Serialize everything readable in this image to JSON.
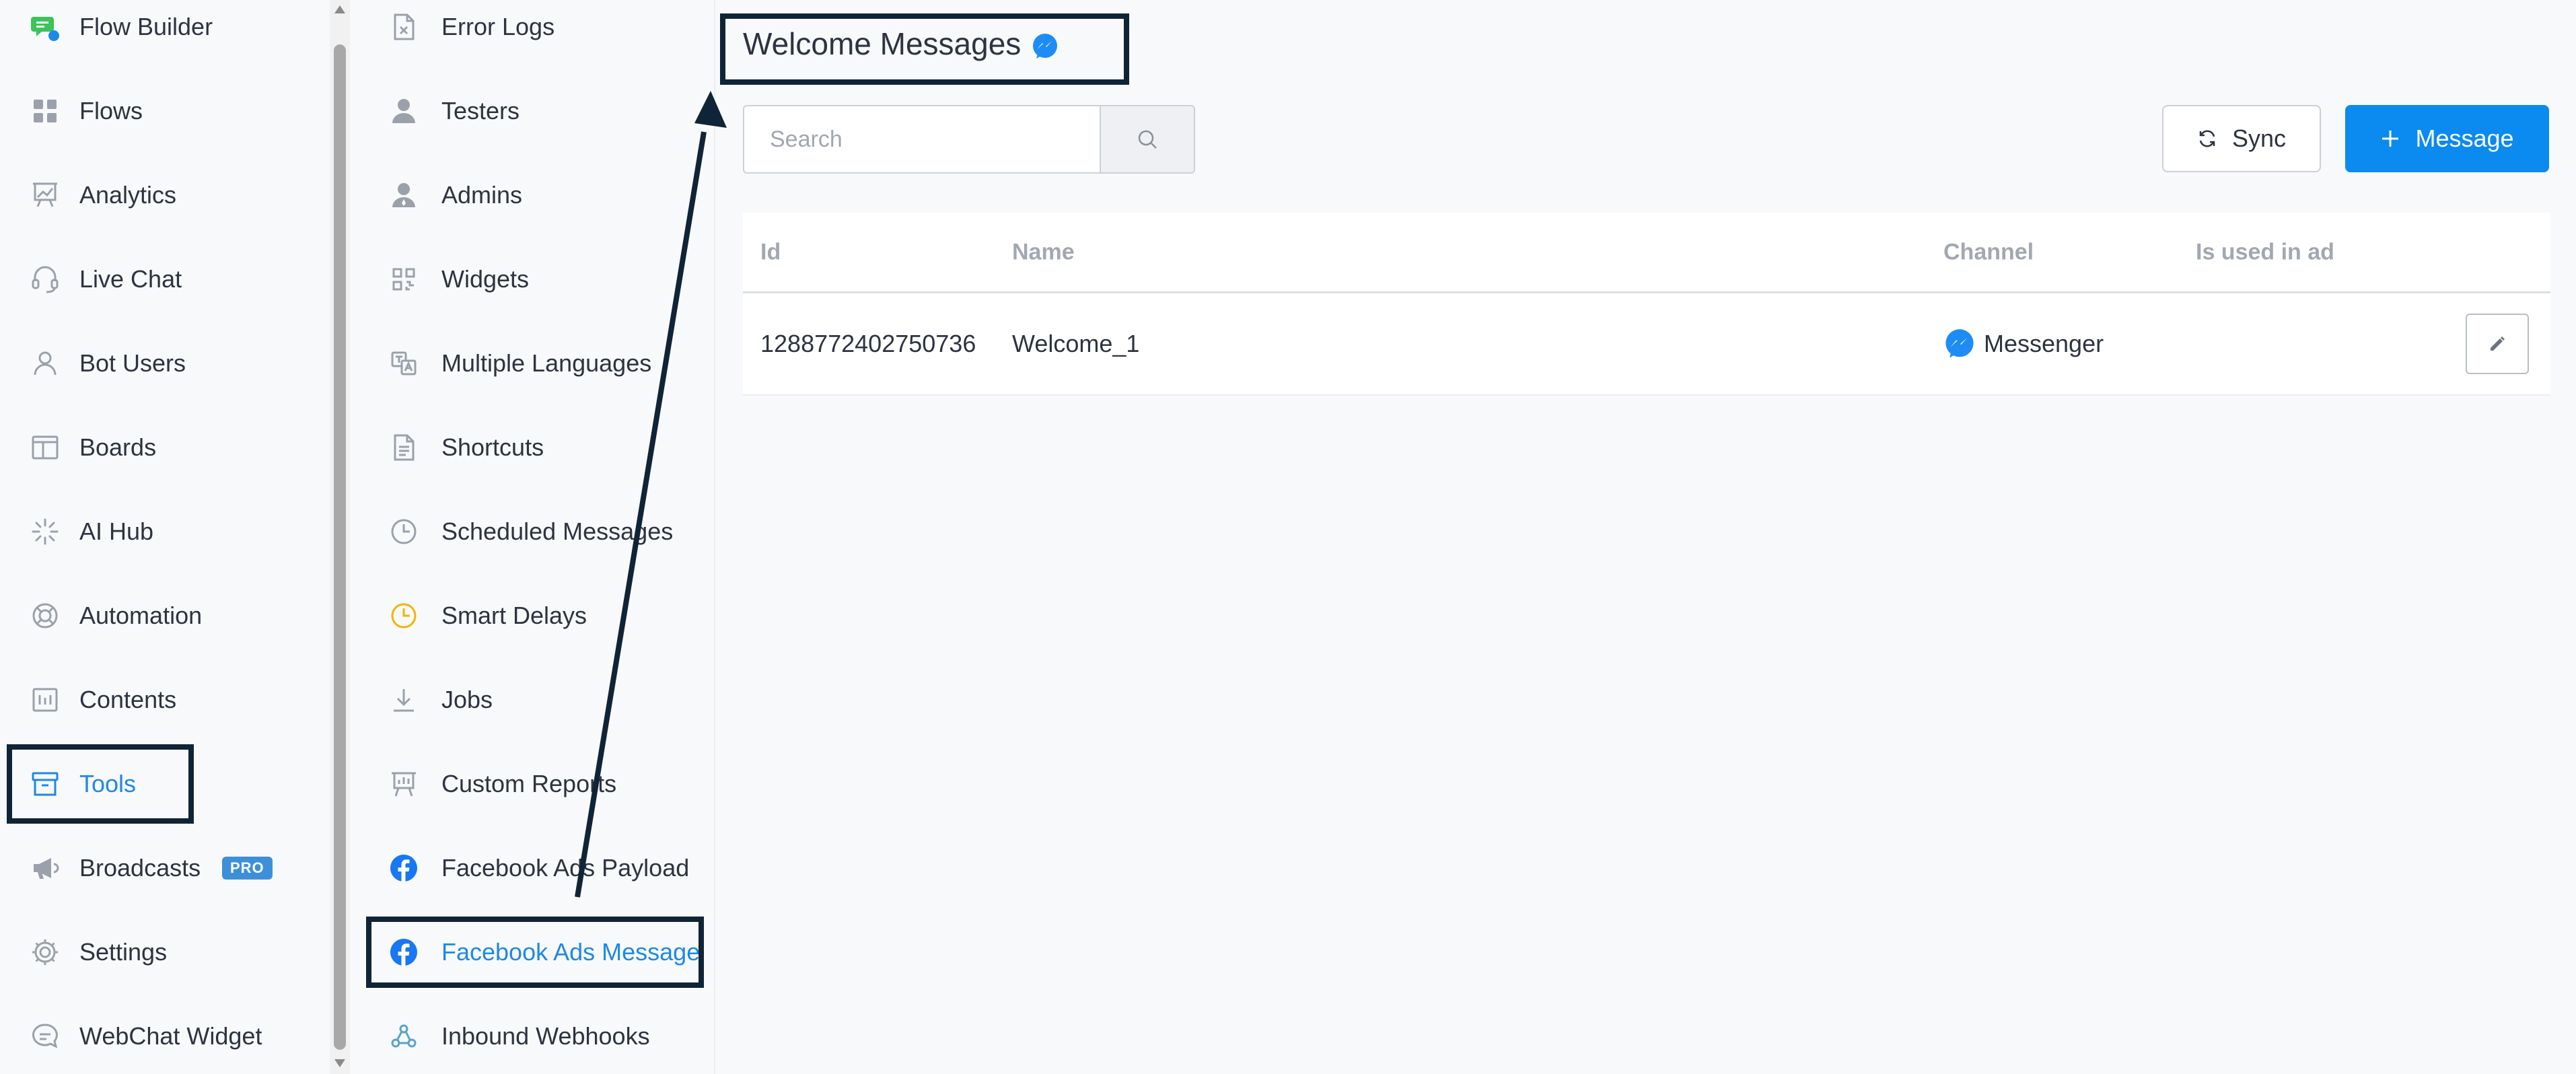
{
  "sidebar": {
    "items": [
      {
        "label": "Flow Builder",
        "icon": "flow-builder-icon"
      },
      {
        "label": "Flows",
        "icon": "grid-icon"
      },
      {
        "label": "Analytics",
        "icon": "chart-icon"
      },
      {
        "label": "Live Chat",
        "icon": "headset-icon"
      },
      {
        "label": "Bot Users",
        "icon": "user-icon"
      },
      {
        "label": "Boards",
        "icon": "board-icon"
      },
      {
        "label": "AI Hub",
        "icon": "sparkle-icon"
      },
      {
        "label": "Automation",
        "icon": "lifebuoy-icon"
      },
      {
        "label": "Contents",
        "icon": "contents-icon"
      },
      {
        "label": "Tools",
        "icon": "archive-box-icon"
      },
      {
        "label": "Broadcasts",
        "icon": "megaphone-icon",
        "badge": "PRO"
      },
      {
        "label": "Settings",
        "icon": "gear-icon"
      },
      {
        "label": "WebChat Widget",
        "icon": "chat-bubble-icon"
      }
    ],
    "active": "Tools"
  },
  "submenu": {
    "items": [
      {
        "label": "Error Logs",
        "icon": "error-file-icon"
      },
      {
        "label": "Testers",
        "icon": "person-icon"
      },
      {
        "label": "Admins",
        "icon": "admin-icon"
      },
      {
        "label": "Widgets",
        "icon": "qr-icon"
      },
      {
        "label": "Multiple Languages",
        "icon": "language-icon"
      },
      {
        "label": "Shortcuts",
        "icon": "document-icon"
      },
      {
        "label": "Scheduled Messages",
        "icon": "clock-icon"
      },
      {
        "label": "Smart Delays",
        "icon": "clock-yellow-icon"
      },
      {
        "label": "Jobs",
        "icon": "download-icon"
      },
      {
        "label": "Custom Reports",
        "icon": "report-icon"
      },
      {
        "label": "Facebook Ads Payload",
        "icon": "facebook-icon"
      },
      {
        "label": "Facebook Ads Message",
        "icon": "facebook-icon"
      },
      {
        "label": "Inbound Webhooks",
        "icon": "webhook-icon"
      }
    ],
    "active": "Facebook Ads Message"
  },
  "main": {
    "title": "Welcome Messages",
    "title_icon": "messenger-icon",
    "search_placeholder": "Search",
    "sync_label": "Sync",
    "add_message_label": "Message",
    "table": {
      "columns": [
        "Id",
        "Name",
        "Channel",
        "Is used in ad"
      ],
      "rows": [
        {
          "id": "1288772402750736",
          "name": "Welcome_1",
          "channel": "Messenger",
          "is_used_in_ad": ""
        }
      ]
    }
  },
  "colors": {
    "accent": "#0b8af0",
    "active_text": "#1e88e5",
    "annotation": "#0f2436",
    "messenger": "#1e8cf5",
    "facebook": "#1877f2"
  }
}
